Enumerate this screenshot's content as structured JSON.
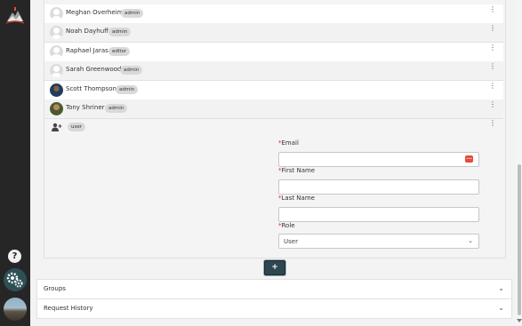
{
  "users": [
    {
      "name": "Meghan Overheim",
      "role": "admin",
      "avatar": "default-avatar"
    },
    {
      "name": "Noah Dayhuff",
      "role": "admin",
      "avatar": "default-avatar"
    },
    {
      "name": "Raphael Jaras",
      "role": "editor",
      "avatar": "default-avatar"
    },
    {
      "name": "Sarah Greenwood",
      "role": "admin",
      "avatar": "default-avatar"
    },
    {
      "name": "Scott Thompson",
      "role": "admin",
      "avatar": "photo-avatar"
    },
    {
      "name": "Tony Shriner",
      "role": "admin",
      "avatar": "photo-avatar"
    }
  ],
  "new_user": {
    "role_badge": "user",
    "form": {
      "email_label": "Email",
      "first_name_label": "First Name",
      "last_name_label": "Last Name",
      "role_label": "Role",
      "required_marker": "*",
      "email_value": "",
      "first_name_value": "",
      "last_name_value": "",
      "role_value": "User"
    }
  },
  "add_button_label": "+",
  "sections": [
    {
      "label": "Groups"
    },
    {
      "label": "Request History"
    }
  ],
  "sidebar": {
    "help_label": "?"
  },
  "icons": {
    "kebab": "more-vertical-icon",
    "add_user": "add-user-icon",
    "settings": "gears-icon",
    "help": "question-icon",
    "chevron": "chevron-down-icon",
    "password_manager": "password-manager-icon"
  },
  "colors": {
    "sidebar_bg": "#262626",
    "add_button_bg": "#2e4650",
    "required": "#d62b2b",
    "badge_bg": "#d9d9d9"
  }
}
